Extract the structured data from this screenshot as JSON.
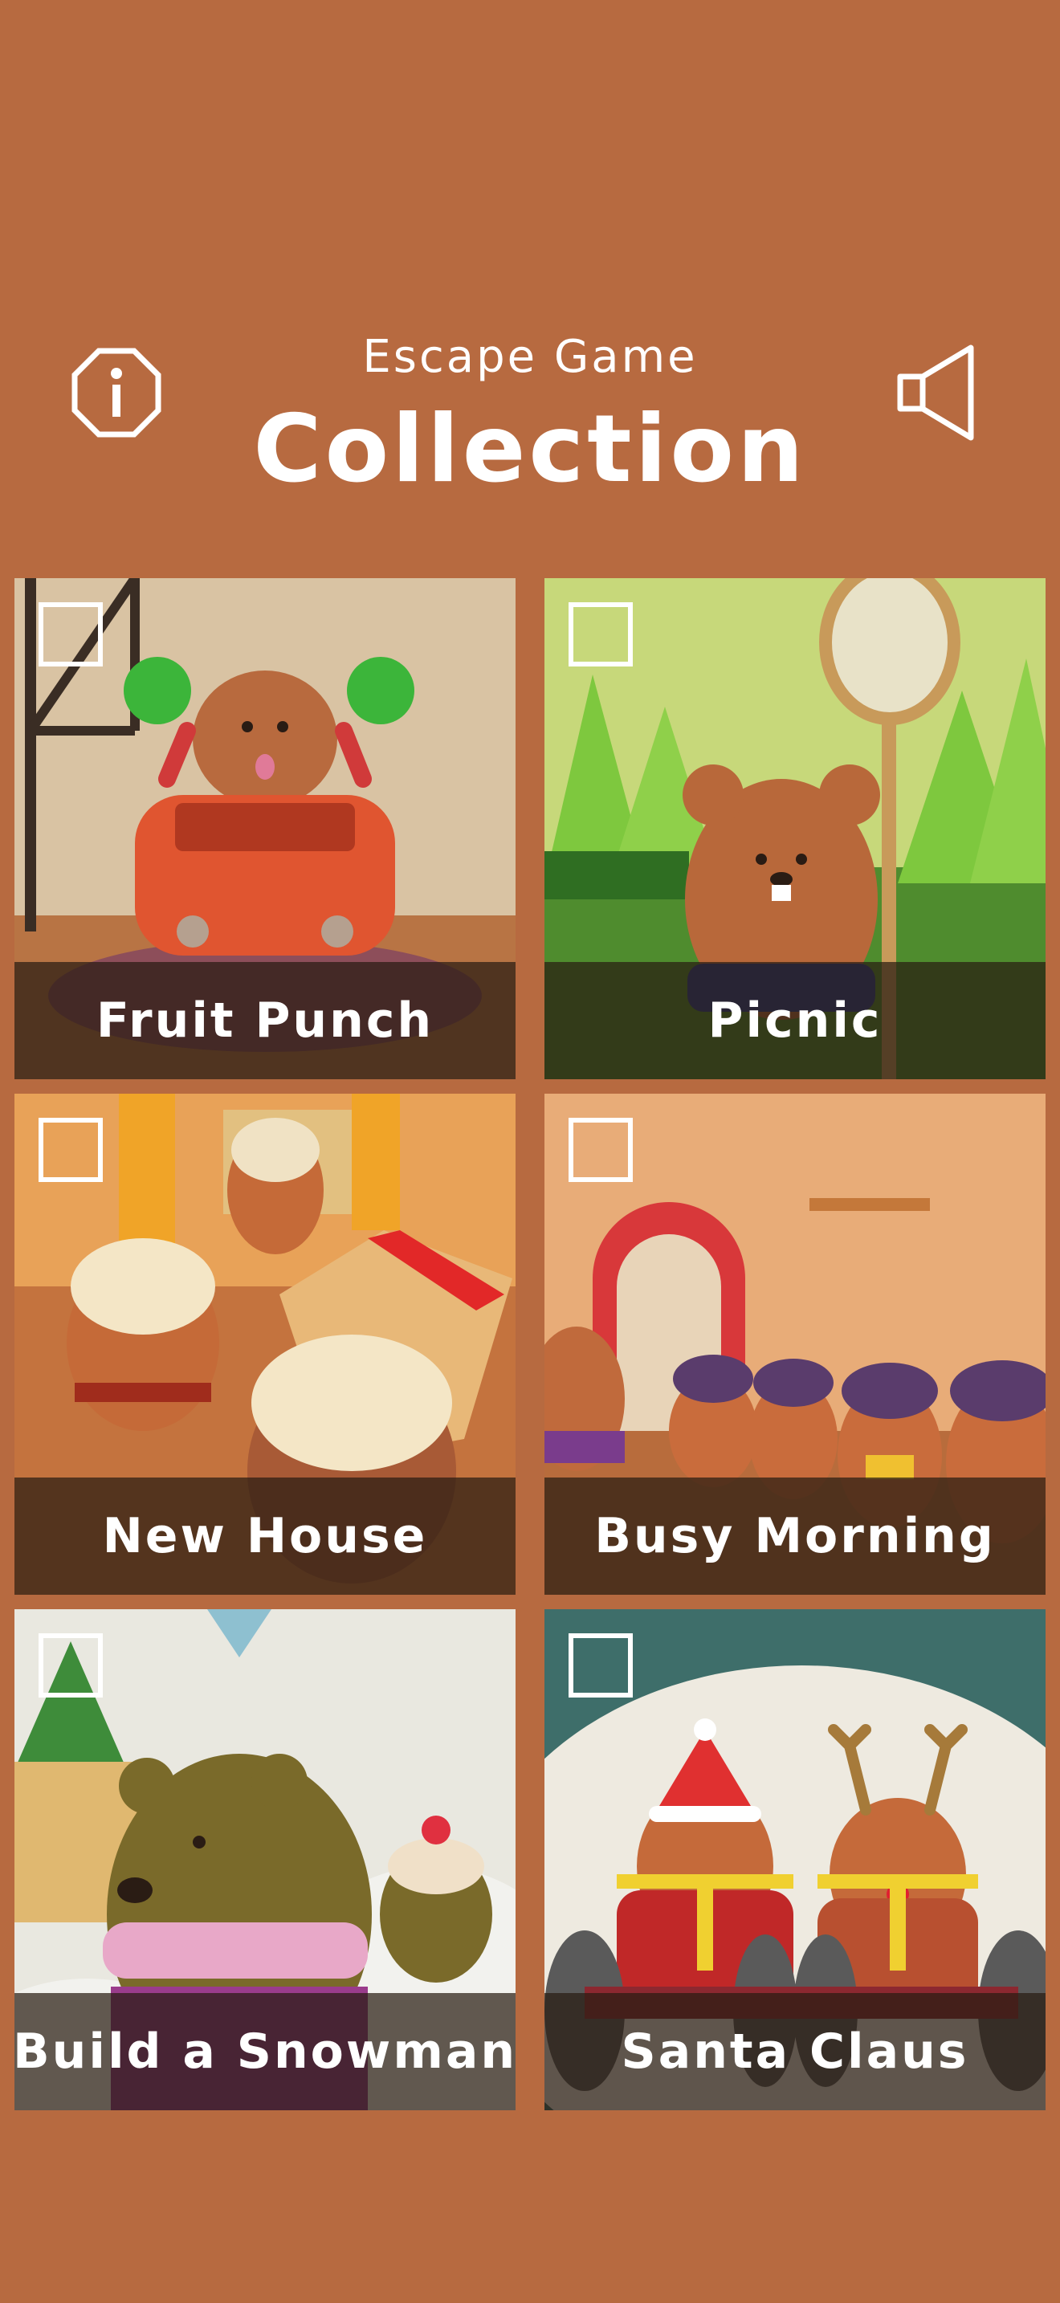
{
  "header": {
    "subtitle": "Escape Game",
    "title": "Collection",
    "info_icon": "info-octagon-icon",
    "sound_icon": "speaker-icon"
  },
  "colors": {
    "background": "#b76a40",
    "label_bar": "#281c12",
    "text": "#ffffff"
  },
  "games": [
    {
      "label": "Fruit Punch",
      "checked": false
    },
    {
      "label": "Picnic",
      "checked": false
    },
    {
      "label": "New House",
      "checked": false
    },
    {
      "label": "Busy Morning",
      "checked": false
    },
    {
      "label": "Build a Snowman",
      "checked": false
    },
    {
      "label": "Santa Claus",
      "checked": false
    }
  ]
}
